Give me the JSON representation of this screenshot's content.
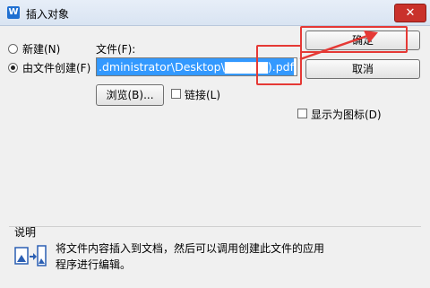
{
  "window": {
    "title": "插入对象",
    "app_icon_letter": "W",
    "close_symbol": "✕"
  },
  "options": {
    "new_label": "新建(N)",
    "from_file_label": "由文件创建(F)"
  },
  "file": {
    "label": "文件(F):",
    "value": ".dministrator\\Desktop\\▇▇▇▇▇).pdf"
  },
  "buttons": {
    "ok": "确定",
    "cancel": "取消",
    "browse": "浏览(B)..."
  },
  "checkboxes": {
    "link": "链接(L)",
    "display_as_icon": "显示为图标(D)"
  },
  "description": {
    "heading": "说明",
    "text": "将文件内容插入到文档，然后可以调用创建此文件的应用程序进行编辑。"
  },
  "annotation_color": "#e53935"
}
